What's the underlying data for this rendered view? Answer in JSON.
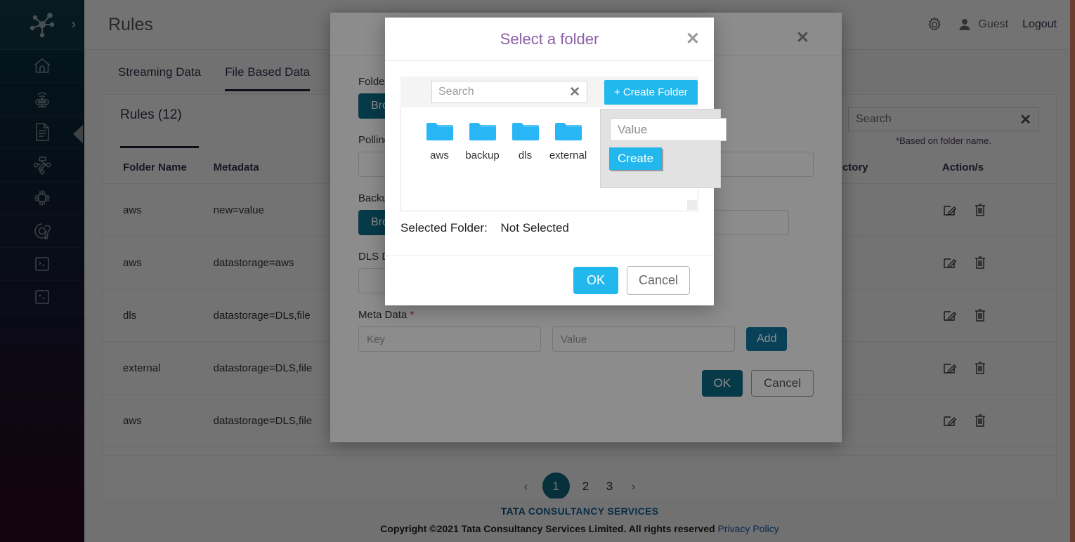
{
  "header": {
    "title": "Rules",
    "user_name": "Guest",
    "logout_label": "Logout",
    "gear_icon": "gear-icon",
    "user_icon": "user-icon"
  },
  "sidebar": {
    "logo_icon": "network-hub-icon",
    "expand_icon": "chevron-right-icon",
    "items": [
      {
        "icon": "home-icon"
      },
      {
        "icon": "iot-device-icon"
      },
      {
        "icon": "document-icon"
      },
      {
        "icon": "design-edit-icon"
      },
      {
        "icon": "chip-icon"
      },
      {
        "icon": "gear-wrench-icon"
      },
      {
        "icon": "terminal-icon"
      },
      {
        "icon": "terminal-alt-icon"
      }
    ]
  },
  "tabs": [
    {
      "label": "Streaming Data",
      "active": false
    },
    {
      "label": "File Based Data",
      "active": true
    }
  ],
  "panel": {
    "title": "Rules (12)",
    "search_placeholder": "Search",
    "search_note": "*Based on folder name.",
    "clear_icon": "close-x-icon"
  },
  "table": {
    "columns": [
      "Folder Name",
      "Metadata",
      "",
      "DLS Directory",
      "Action/s"
    ],
    "rows": [
      {
        "folder_name": "aws",
        "metadata": "new=value",
        "col3": "",
        "dls_directory": ""
      },
      {
        "folder_name": "aws",
        "metadata": "datastorage=aws",
        "col3": "",
        "dls_directory": ""
      },
      {
        "folder_name": "dls",
        "metadata": "datastorage=DLs,file",
        "col3": "",
        "dls_directory": ""
      },
      {
        "folder_name": "external",
        "metadata": "datastorage=DLS,file",
        "col3": "",
        "dls_directory": ""
      },
      {
        "folder_name": "aws",
        "metadata": "datastorage=DLS,file",
        "col3": "",
        "dls_directory": ""
      }
    ],
    "edit_icon": "edit-icon",
    "delete_icon": "trash-icon"
  },
  "pagination": {
    "prev": "‹",
    "pages": [
      "1",
      "2",
      "3"
    ],
    "current": "1",
    "next": "›"
  },
  "footer": {
    "brand_bold": "TATA",
    "brand_rest": "CONSULTANCY SERVICES",
    "copyright": "Copyright ©2021 Tata Consultancy Services Limited. All rights reserved",
    "privacy_link": "Privacy Policy"
  },
  "rule_modal": {
    "close_icon": "close-x-icon",
    "folder_label": "Folder",
    "folder_browse": "Browse",
    "polling_label": "Polling",
    "polling_value": "",
    "backup_label": "Backup",
    "backup_browse": "Browse",
    "dls_label": "DLS Directory",
    "dls_value": "",
    "meta_label": "Meta Data",
    "meta_required": "*",
    "meta_key_placeholder": "Key",
    "meta_value_placeholder": "Value",
    "add_label": "Add",
    "ok_label": "OK",
    "cancel_label": "Cancel"
  },
  "folder_dialog": {
    "title": "Select a folder",
    "close_icon": "close-x-icon",
    "search_placeholder": "Search",
    "search_clear_icon": "close-x-icon",
    "create_folder_label": "+ Create Folder",
    "folders": [
      {
        "name": "aws",
        "icon": "folder-icon"
      },
      {
        "name": "backup",
        "icon": "folder-icon"
      },
      {
        "name": "dls",
        "icon": "folder-icon"
      },
      {
        "name": "external",
        "icon": "folder-icon"
      }
    ],
    "selected_label": "Selected Folder:",
    "selected_value": "Not Selected",
    "ok_label": "OK",
    "cancel_label": "Cancel",
    "resize_handle_icon": "resize-handle-icon"
  },
  "create_folder_popup": {
    "value_placeholder": "Value",
    "create_label": "Create"
  },
  "colors": {
    "accent_cyan": "#22b8ed",
    "accent_teal": "#0e6b84",
    "title_purple": "#8e5fa8",
    "folder_blue": "#29b6f6",
    "right_stripe": "#f0896a",
    "tab_underline": "#2b1b38"
  }
}
